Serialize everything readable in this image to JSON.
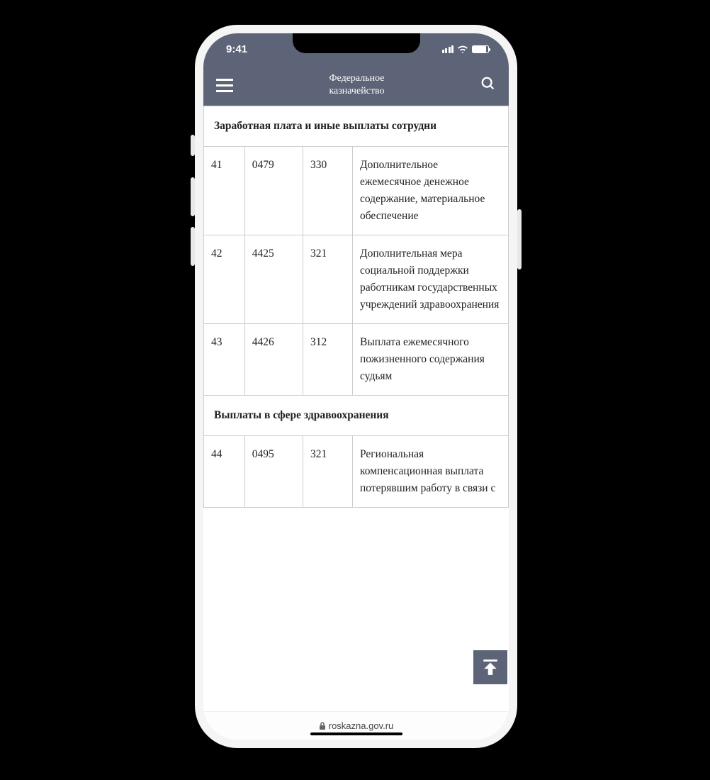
{
  "status": {
    "time": "9:41"
  },
  "header": {
    "title_line1": "Федеральное",
    "title_line2": "казначейство"
  },
  "sections": [
    {
      "title": "Заработная плата и иные выплаты сотрудни"
    },
    {
      "title": "Выплаты в сфере здравоохранения"
    }
  ],
  "rows_a": [
    {
      "c1": "41",
      "c2": "0479",
      "c3": "330",
      "desc": "Дополнительное ежемесячное денежное содержание, материальное обеспечение"
    },
    {
      "c1": "42",
      "c2": "4425",
      "c3": "321",
      "desc": "Дополнительная мера социальной поддержки работникам государственных учреждений здравоохранения"
    },
    {
      "c1": "43",
      "c2": "4426",
      "c3": "312",
      "desc": "Выплата ежемесячного пожизненного содержания судьям"
    }
  ],
  "rows_b": [
    {
      "c1": "44",
      "c2": "0495",
      "c3": "321",
      "desc": "Региональная компенсационная выплата потерявшим работу в связи с"
    }
  ],
  "footer": {
    "domain": "roskazna.gov.ru"
  }
}
